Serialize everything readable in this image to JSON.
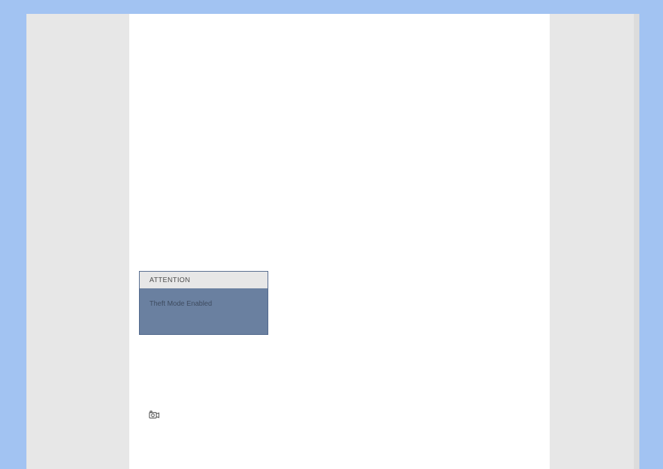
{
  "notice": {
    "header": "ATTENTION",
    "body": "Theft Mode Enabled"
  }
}
